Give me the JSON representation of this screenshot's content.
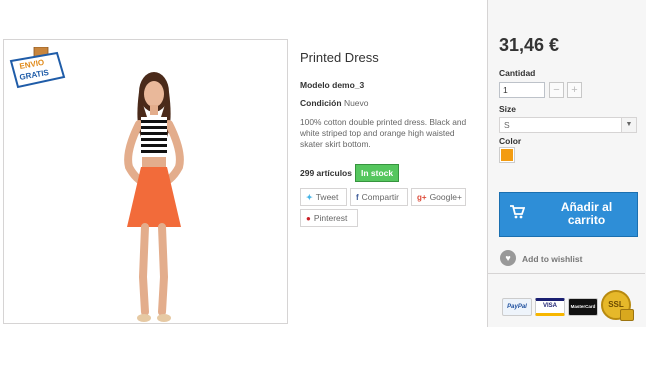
{
  "product": {
    "badge_line1": "ENVIO",
    "badge_line2": "GRATIS",
    "title": "Printed Dress",
    "model_label": "Modelo",
    "model_value": "demo_3",
    "condition_label": "Condición",
    "condition_value": "Nuevo",
    "description": "100% cotton double printed dress. Black and white striped top and orange high waisted skater skirt bottom.",
    "quantity_text": "299 artículos",
    "stock_text": "In stock"
  },
  "share": {
    "tweet": "Tweet",
    "facebook": "Compartir",
    "google": "Google+",
    "pinterest": "Pinterest"
  },
  "buy": {
    "price": "31,46 €",
    "quantity_label": "Cantidad",
    "quantity_value": "1",
    "minus": "−",
    "plus": "+",
    "size_label": "Size",
    "size_value": "S",
    "color_label": "Color",
    "color_value": "#f39c11",
    "cart_label": "Añadir al carrito",
    "wishlist_label": "Add to wishlist"
  },
  "payments": {
    "paypal": "PayPal",
    "visa": "VISA",
    "mastercard": "MasterCard",
    "ssl": "SSL"
  },
  "colors": {
    "stock_green": "#55c65e",
    "cart_blue": "#2e8ed7",
    "swatch_orange": "#f39c11"
  }
}
